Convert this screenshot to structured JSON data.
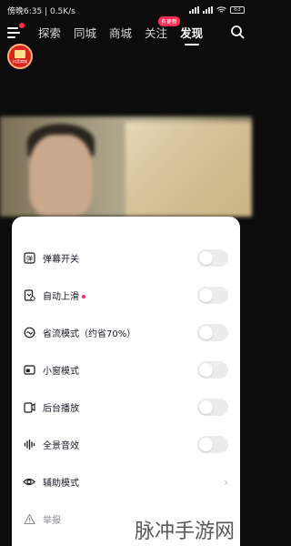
{
  "status_bar": {
    "time_speed": "傍晚6:35 | 0.5K/s",
    "battery": "63"
  },
  "top_nav": {
    "tabs": [
      {
        "label": "探索",
        "active": false
      },
      {
        "label": "同城",
        "active": false
      },
      {
        "label": "商城",
        "active": false
      },
      {
        "label": "关注",
        "active": false,
        "badge": "有更新"
      },
      {
        "label": "发现",
        "active": true
      }
    ]
  },
  "promo": {
    "label": "抖音商城"
  },
  "settings_sheet": {
    "items": [
      {
        "icon": "danmaku-icon",
        "label": "弹幕开关",
        "control": "toggle",
        "on": false
      },
      {
        "icon": "auto-scroll-icon",
        "label": "自动上滑",
        "control": "toggle",
        "on": false,
        "dot": true
      },
      {
        "icon": "data-saver-icon",
        "label": "省流模式（约省70%）",
        "control": "toggle",
        "on": false
      },
      {
        "icon": "mini-window-icon",
        "label": "小窗模式",
        "control": "toggle",
        "on": false
      },
      {
        "icon": "background-play-icon",
        "label": "后台播放",
        "control": "toggle",
        "on": false
      },
      {
        "icon": "surround-sound-icon",
        "label": "全景音效",
        "control": "toggle",
        "on": false
      },
      {
        "icon": "eye-icon",
        "label": "辅助模式",
        "control": "chevron"
      },
      {
        "icon": "warning-icon",
        "label": "举报",
        "control": "none"
      }
    ]
  },
  "watermark": "脉冲手游网",
  "colors": {
    "accent": "#fe2c55",
    "toggle_off": "#ececee"
  }
}
